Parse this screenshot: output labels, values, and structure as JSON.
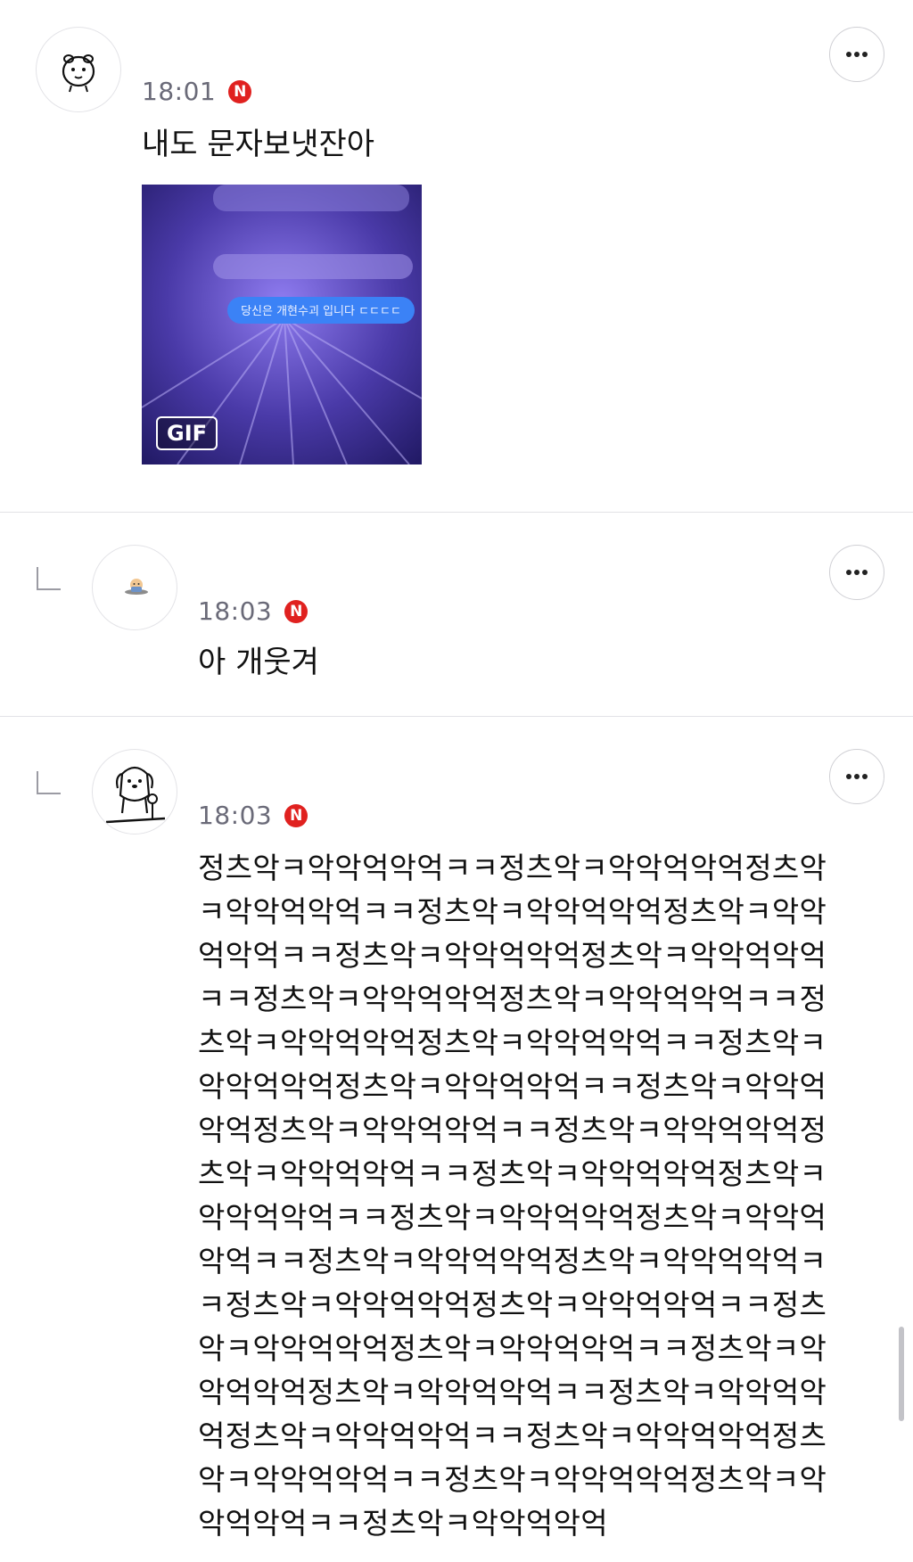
{
  "comments": [
    {
      "time": "18:01",
      "badge": "N",
      "text": "내도 문자보냇잔아",
      "attachment": {
        "label": "GIF",
        "bubble_text": "당신은 개현수괴 입니다 ㄷㄷㄷㄷ"
      },
      "is_reply": false
    },
    {
      "time": "18:03",
      "badge": "N",
      "text": "아 개웃겨",
      "is_reply": true
    },
    {
      "time": "18:03",
      "badge": "N",
      "text": "정츠악ㅋ악악억악억ㅋㅋ정츠악ㅋ악악억악억정츠악ㅋ악악억악억ㅋㅋ정츠악ㅋ악악억악억정츠악ㅋ악악억악억ㅋㅋ정츠악ㅋ악악억악억정츠악ㅋ악악억악억ㅋㅋ정츠악ㅋ악악억악억정츠악ㅋ악악억악억ㅋㅋ정츠악ㅋ악악억악억정츠악ㅋ악악억악억ㅋㅋ정츠악ㅋ악악억악억정츠악ㅋ악악억악억ㅋㅋ정츠악ㅋ악악억악억정츠악ㅋ악악억악억ㅋㅋ정츠악ㅋ악악억악억정츠악ㅋ악악억악억ㅋㅋ정츠악ㅋ악악억악억정츠악ㅋ악악억악억ㅋㅋ정츠악ㅋ악악억악억정츠악ㅋ악악억악억ㅋㅋ정츠악ㅋ악악억악억정츠악ㅋ악악억악억ㅋㅋ정츠악ㅋ악악억악억정츠악ㅋ악악억악억ㅋㅋ정츠악ㅋ악악억악억정츠악ㅋ악악억악억ㅋㅋ정츠악ㅋ악악억악억정츠악ㅋ악악억악억ㅋㅋ정츠악ㅋ악악억악억정츠악ㅋ악악억악억ㅋㅋ정츠악ㅋ악악억악억정츠악ㅋ악악억악억ㅋㅋ정츠악ㅋ악악억악억정츠악ㅋ악악억악억ㅋㅋ정츠악ㅋ악악억악억",
      "is_reply": true
    }
  ],
  "colors": {
    "badge": "#e0211f",
    "time": "#6a6a78",
    "divider": "#e2e2e6"
  },
  "icons": {
    "more": "more-horizontal-icon",
    "reply": "reply-arrow-icon",
    "badge": "naver-n-icon"
  }
}
